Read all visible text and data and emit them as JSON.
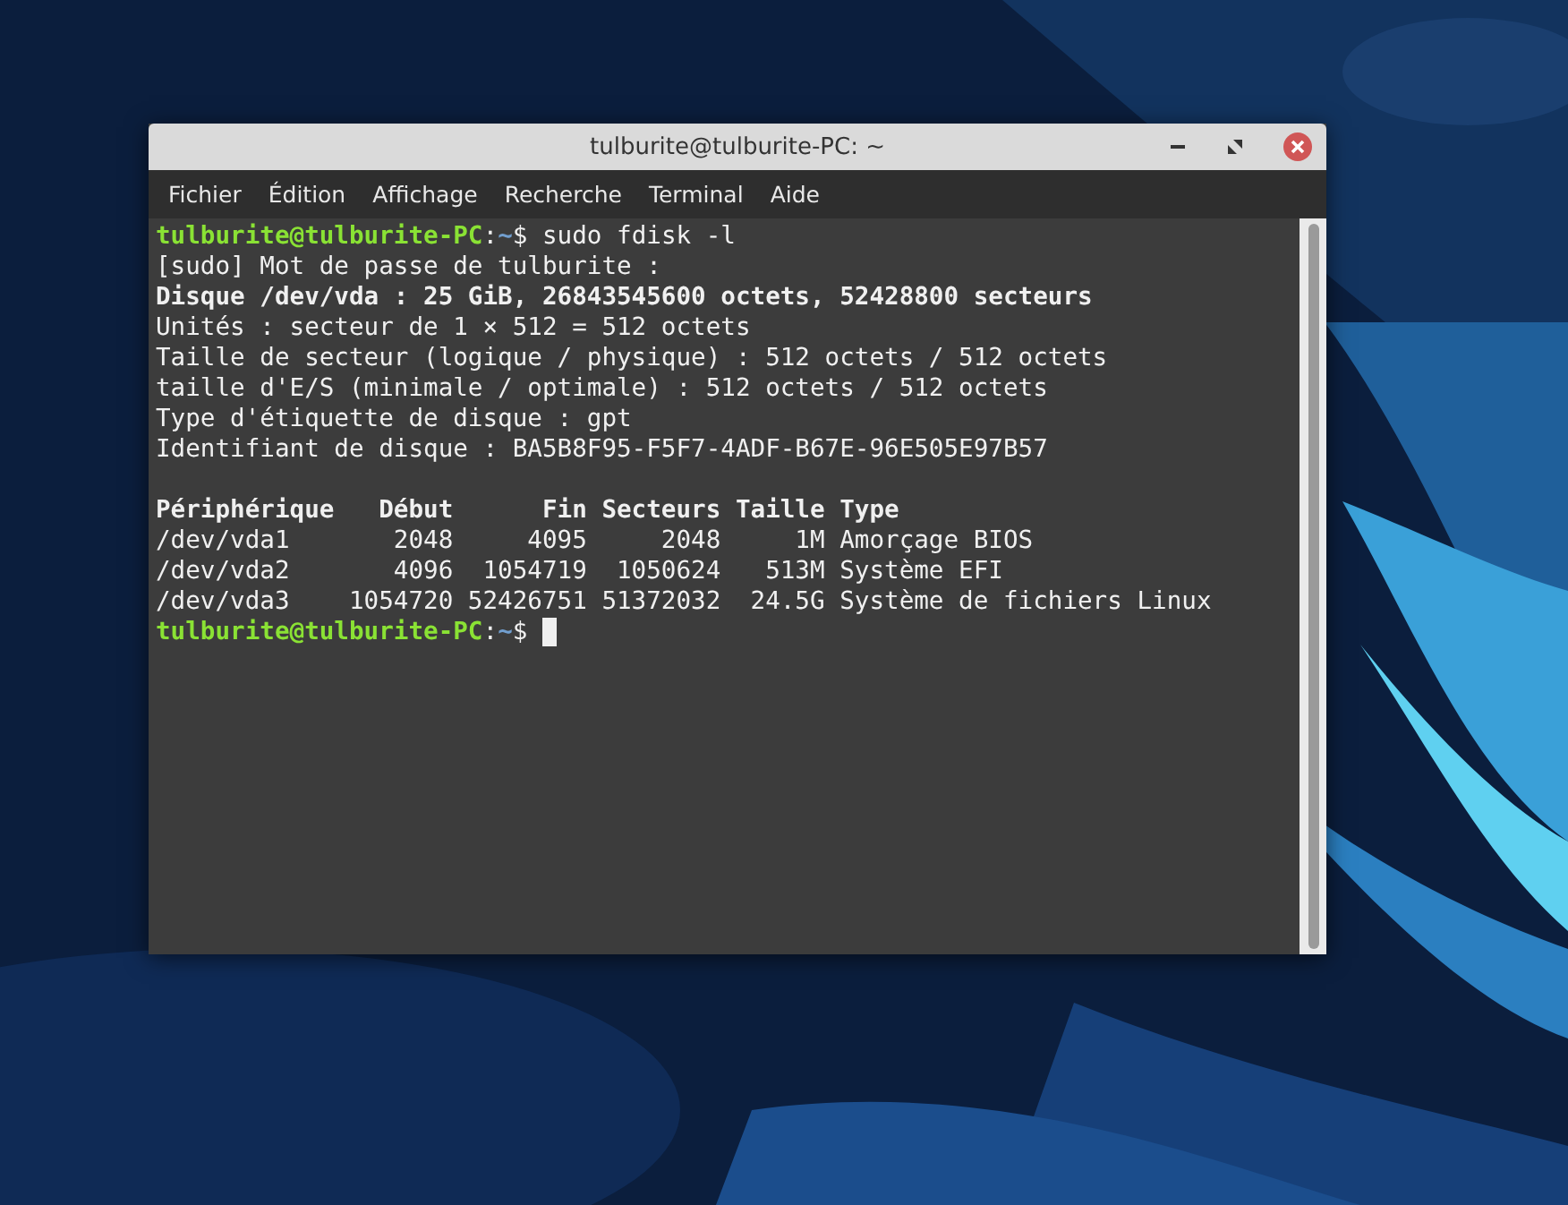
{
  "window": {
    "title": "tulburite@tulburite-PC: ~"
  },
  "menu": [
    "Fichier",
    "Édition",
    "Affichage",
    "Recherche",
    "Terminal",
    "Aide"
  ],
  "terminal": {
    "lines": [
      {
        "kind": "prompt",
        "user": "tulburite@tulburite-PC",
        "separator": ":",
        "path": "~",
        "sign": "$",
        "command": "sudo fdisk -l",
        "cursor": false
      },
      {
        "kind": "text",
        "text": "[sudo] Mot de passe de tulburite :"
      },
      {
        "kind": "bold",
        "text": "Disque /dev/vda : 25 GiB, 26843545600 octets, 52428800 secteurs"
      },
      {
        "kind": "text",
        "text": "Unités : secteur de 1 × 512 = 512 octets"
      },
      {
        "kind": "text",
        "text": "Taille de secteur (logique / physique) : 512 octets / 512 octets"
      },
      {
        "kind": "text",
        "text": "taille d'E/S (minimale / optimale) : 512 octets / 512 octets"
      },
      {
        "kind": "text",
        "text": "Type d'étiquette de disque : gpt"
      },
      {
        "kind": "text",
        "text": "Identifiant de disque : BA5B8F95-F5F7-4ADF-B67E-96E505E97B57"
      },
      {
        "kind": "blank"
      },
      {
        "kind": "bold",
        "text": "Périphérique   Début      Fin Secteurs Taille Type"
      },
      {
        "kind": "text",
        "text": "/dev/vda1       2048     4095     2048     1M Amorçage BIOS"
      },
      {
        "kind": "text",
        "text": "/dev/vda2       4096  1054719  1050624   513M Système EFI"
      },
      {
        "kind": "text",
        "text": "/dev/vda3    1054720 52426751 51372032  24.5G Système de fichiers Linux"
      },
      {
        "kind": "prompt",
        "user": "tulburite@tulburite-PC",
        "separator": ":",
        "path": "~",
        "sign": "$",
        "cursor": true
      }
    ]
  }
}
